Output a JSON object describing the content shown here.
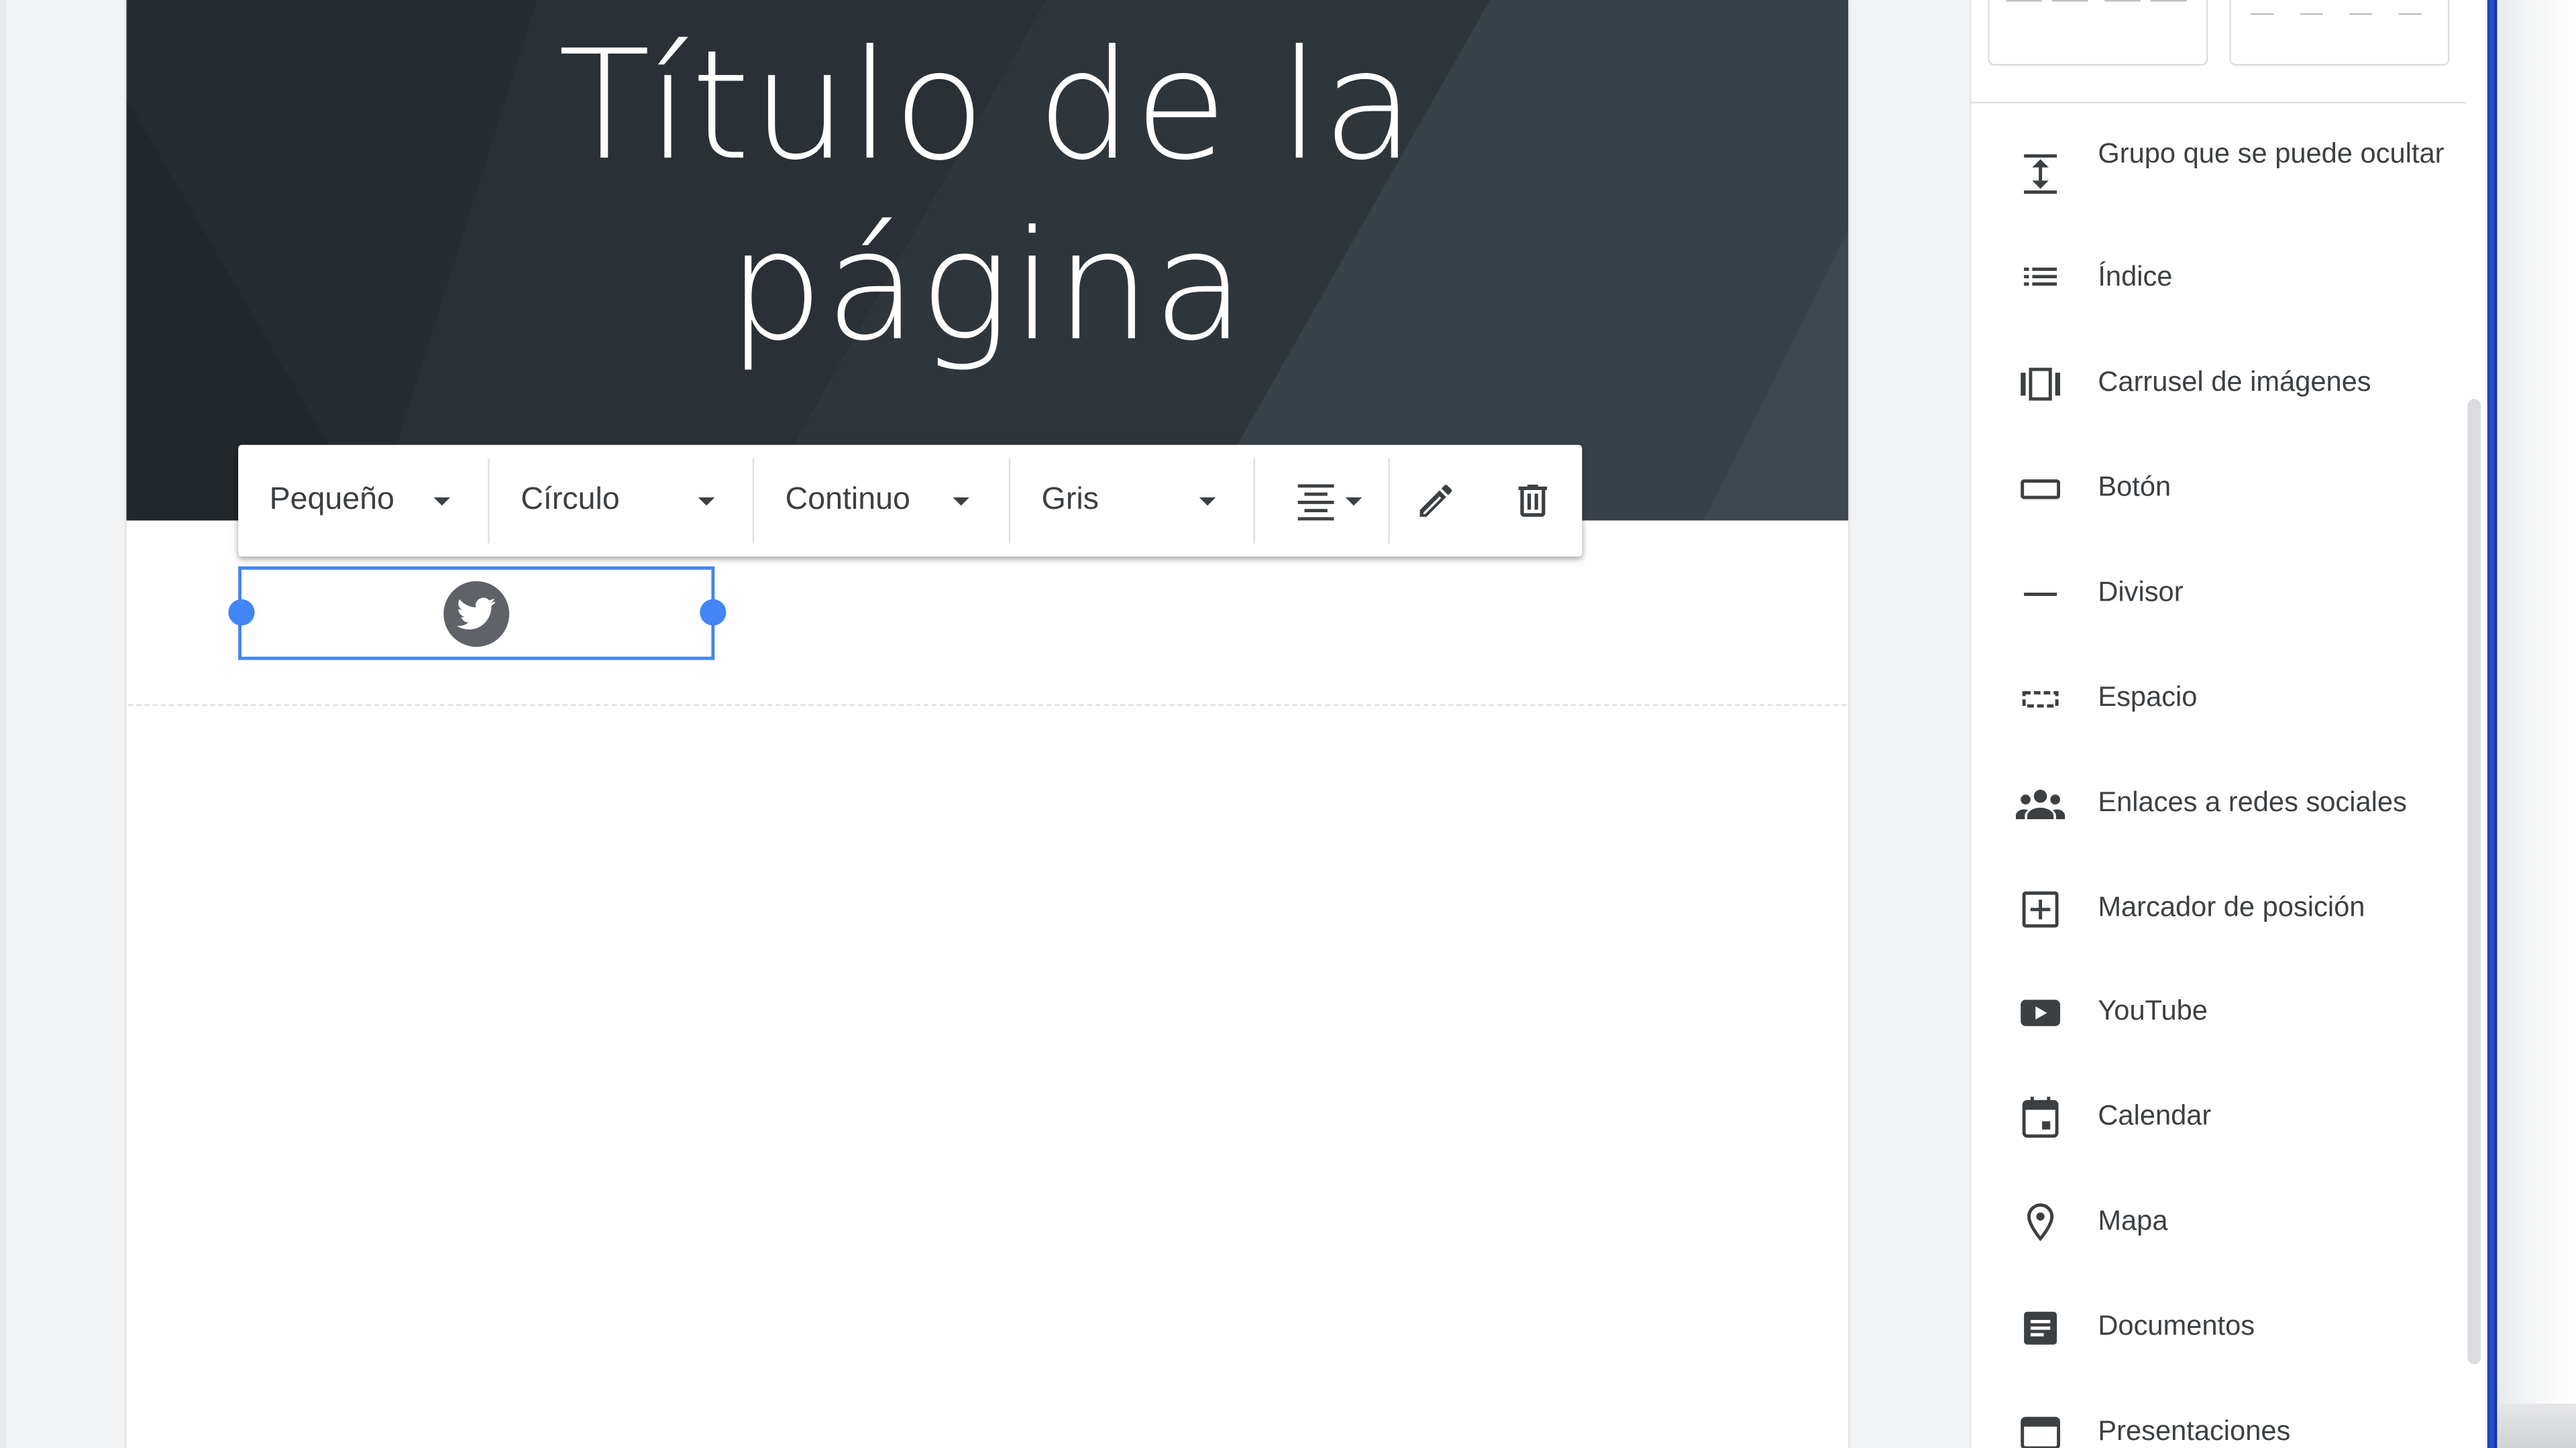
{
  "header": {
    "title": "Título de la\npágina",
    "banner_color": "#2d3439"
  },
  "toolbar": {
    "size_dropdown": "Pequeño",
    "shape_dropdown": "Círculo",
    "style_dropdown": "Continuo",
    "color_dropdown": "Gris",
    "align_icon": "align-center-icon",
    "edit_icon": "pencil-icon",
    "delete_icon": "trash-icon"
  },
  "widget": {
    "icon": "twitter-icon",
    "selection_color": "#4285f4"
  },
  "side_panel": {
    "items": [
      {
        "label": "Grupo que se puede ocultar",
        "icon": "collapsible-group-icon"
      },
      {
        "label": "Índice",
        "icon": "table-of-contents-icon"
      },
      {
        "label": "Carrusel de imágenes",
        "icon": "image-carousel-icon"
      },
      {
        "label": "Botón",
        "icon": "button-icon"
      },
      {
        "label": "Divisor",
        "icon": "divider-icon"
      },
      {
        "label": "Espacio",
        "icon": "spacer-icon"
      },
      {
        "label": "Enlaces a redes sociales",
        "icon": "people-icon"
      },
      {
        "label": "Marcador de posición",
        "icon": "add-box-icon"
      },
      {
        "label": "YouTube",
        "icon": "youtube-icon"
      },
      {
        "label": "Calendar",
        "icon": "calendar-icon"
      },
      {
        "label": "Mapa",
        "icon": "map-pin-icon"
      },
      {
        "label": "Documentos",
        "icon": "docs-icon"
      },
      {
        "label": "Presentaciones",
        "icon": "slides-icon"
      }
    ]
  }
}
